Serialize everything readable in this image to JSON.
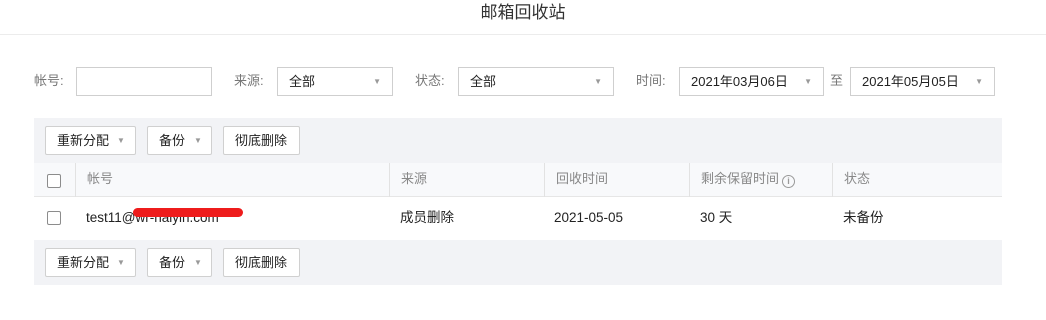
{
  "header": {
    "title": "邮箱回收站"
  },
  "filters": {
    "account_label": "帐号:",
    "account_value": "",
    "source_label": "来源:",
    "source_value": "全部",
    "status_label": "状态:",
    "status_value": "全部",
    "time_label": "时间:",
    "time_start": "2021年03月06日",
    "time_separator": "至",
    "time_end": "2021年05月05日"
  },
  "toolbar": {
    "reassign_label": "重新分配",
    "backup_label": "备份",
    "delete_label": "彻底删除"
  },
  "table": {
    "columns": {
      "account": "帐号",
      "source": "来源",
      "recycle_time": "回收时间",
      "remaining_time": "剩余保留时间",
      "status": "状态"
    },
    "rows": [
      {
        "account": "test11@wr-haiyin.com",
        "source": "成员删除",
        "recycle_time": "2021-05-05",
        "remaining_time": "30 天",
        "status": "未备份"
      }
    ]
  },
  "icons": {
    "caret": "caret-down-icon",
    "info": "info-icon"
  },
  "colors": {
    "panel_bg": "#f2f3f6",
    "redaction": "#ee1c1c"
  }
}
